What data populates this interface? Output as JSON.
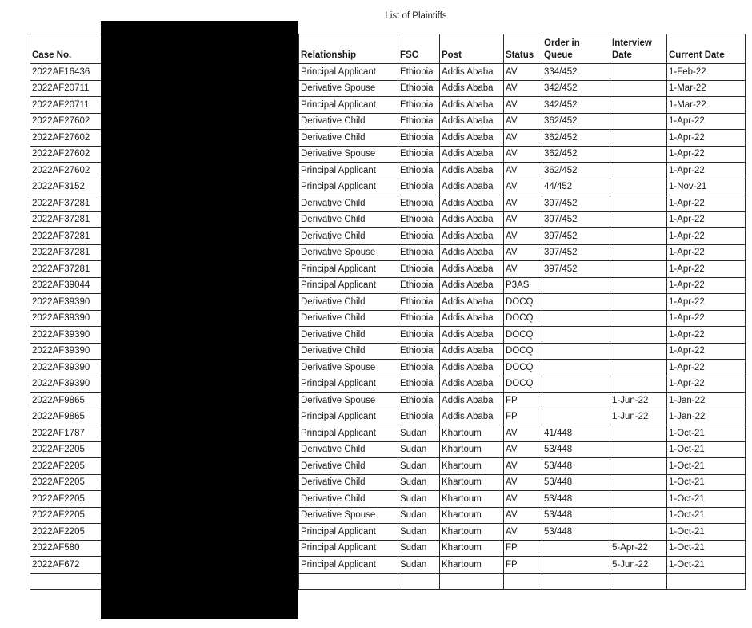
{
  "document": {
    "title": "List of Plaintiffs"
  },
  "table": {
    "headers": {
      "case_no": "Case No.",
      "name": "",
      "relationship": "Relationship",
      "fsc": "FSC",
      "post": "Post",
      "status": "Status",
      "order_in_queue": "Order in Queue",
      "interview_date": "Interview Date",
      "current_date": "Current Date"
    },
    "rows": [
      [
        "2022AF16436",
        "",
        "Principal Applicant",
        "Ethiopia",
        "Addis Ababa",
        "AV",
        "334/452",
        "",
        "1-Feb-22"
      ],
      [
        "2022AF20711",
        "",
        "Derivative Spouse",
        "Ethiopia",
        "Addis Ababa",
        "AV",
        "342/452",
        "",
        "1-Mar-22"
      ],
      [
        "2022AF20711",
        "",
        "Principal Applicant",
        "Ethiopia",
        "Addis Ababa",
        "AV",
        "342/452",
        "",
        "1-Mar-22"
      ],
      [
        "2022AF27602",
        "",
        "Derivative Child",
        "Ethiopia",
        "Addis Ababa",
        "AV",
        "362/452",
        "",
        "1-Apr-22"
      ],
      [
        "2022AF27602",
        "",
        "Derivative Child",
        "Ethiopia",
        "Addis Ababa",
        "AV",
        "362/452",
        "",
        "1-Apr-22"
      ],
      [
        "2022AF27602",
        "",
        "Derivative Spouse",
        "Ethiopia",
        "Addis Ababa",
        "AV",
        "362/452",
        "",
        "1-Apr-22"
      ],
      [
        "2022AF27602",
        "",
        "Principal Applicant",
        "Ethiopia",
        "Addis Ababa",
        "AV",
        "362/452",
        "",
        "1-Apr-22"
      ],
      [
        "2022AF3152",
        "",
        "Principal Applicant",
        "Ethiopia",
        "Addis Ababa",
        "AV",
        "44/452",
        "",
        "1-Nov-21"
      ],
      [
        "2022AF37281",
        "",
        "Derivative Child",
        "Ethiopia",
        "Addis Ababa",
        "AV",
        "397/452",
        "",
        "1-Apr-22"
      ],
      [
        "2022AF37281",
        "",
        "Derivative Child",
        "Ethiopia",
        "Addis Ababa",
        "AV",
        "397/452",
        "",
        "1-Apr-22"
      ],
      [
        "2022AF37281",
        "",
        "Derivative Child",
        "Ethiopia",
        "Addis Ababa",
        "AV",
        "397/452",
        "",
        "1-Apr-22"
      ],
      [
        "2022AF37281",
        "",
        "Derivative Spouse",
        "Ethiopia",
        "Addis Ababa",
        "AV",
        "397/452",
        "",
        "1-Apr-22"
      ],
      [
        "2022AF37281",
        "",
        "Principal Applicant",
        "Ethiopia",
        "Addis Ababa",
        "AV",
        "397/452",
        "",
        "1-Apr-22"
      ],
      [
        "2022AF39044",
        "",
        "Principal Applicant",
        "Ethiopia",
        "Addis Ababa",
        "P3AS",
        "",
        "",
        "1-Apr-22"
      ],
      [
        "2022AF39390",
        "",
        "Derivative Child",
        "Ethiopia",
        "Addis Ababa",
        "DOCQ",
        "",
        "",
        "1-Apr-22"
      ],
      [
        "2022AF39390",
        "",
        "Derivative Child",
        "Ethiopia",
        "Addis Ababa",
        "DOCQ",
        "",
        "",
        "1-Apr-22"
      ],
      [
        "2022AF39390",
        "",
        "Derivative Child",
        "Ethiopia",
        "Addis Ababa",
        "DOCQ",
        "",
        "",
        "1-Apr-22"
      ],
      [
        "2022AF39390",
        "",
        "Derivative Child",
        "Ethiopia",
        "Addis Ababa",
        "DOCQ",
        "",
        "",
        "1-Apr-22"
      ],
      [
        "2022AF39390",
        "",
        "Derivative Spouse",
        "Ethiopia",
        "Addis Ababa",
        "DOCQ",
        "",
        "",
        "1-Apr-22"
      ],
      [
        "2022AF39390",
        "",
        "Principal Applicant",
        "Ethiopia",
        "Addis Ababa",
        "DOCQ",
        "",
        "",
        "1-Apr-22"
      ],
      [
        "2022AF9865",
        "",
        "Derivative Spouse",
        "Ethiopia",
        "Addis Ababa",
        "FP",
        "",
        "1-Jun-22",
        "1-Jan-22"
      ],
      [
        "2022AF9865",
        "",
        "Principal Applicant",
        "Ethiopia",
        "Addis Ababa",
        "FP",
        "",
        "1-Jun-22",
        "1-Jan-22"
      ],
      [
        "2022AF1787",
        "",
        "Principal Applicant",
        "Sudan",
        "Khartoum",
        "AV",
        "41/448",
        "",
        "1-Oct-21"
      ],
      [
        "2022AF2205",
        "",
        "Derivative Child",
        "Sudan",
        "Khartoum",
        "AV",
        "53/448",
        "",
        "1-Oct-21"
      ],
      [
        "2022AF2205",
        "",
        "Derivative Child",
        "Sudan",
        "Khartoum",
        "AV",
        "53/448",
        "",
        "1-Oct-21"
      ],
      [
        "2022AF2205",
        "",
        "Derivative Child",
        "Sudan",
        "Khartoum",
        "AV",
        "53/448",
        "",
        "1-Oct-21"
      ],
      [
        "2022AF2205",
        "",
        "Derivative Child",
        "Sudan",
        "Khartoum",
        "AV",
        "53/448",
        "",
        "1-Oct-21"
      ],
      [
        "2022AF2205",
        "",
        "Derivative Spouse",
        "Sudan",
        "Khartoum",
        "AV",
        "53/448",
        "",
        "1-Oct-21"
      ],
      [
        "2022AF2205",
        "",
        "Principal Applicant",
        "Sudan",
        "Khartoum",
        "AV",
        "53/448",
        "",
        "1-Oct-21"
      ],
      [
        "2022AF580",
        "",
        "Principal Applicant",
        "Sudan",
        "Khartoum",
        "FP",
        "",
        "5-Apr-22",
        "1-Oct-21"
      ],
      [
        "2022AF672",
        "",
        "Principal Applicant",
        "Sudan",
        "Khartoum",
        "FP",
        "",
        "5-Jun-22",
        "1-Oct-21"
      ]
    ],
    "trailing_blank_rows": 1
  }
}
